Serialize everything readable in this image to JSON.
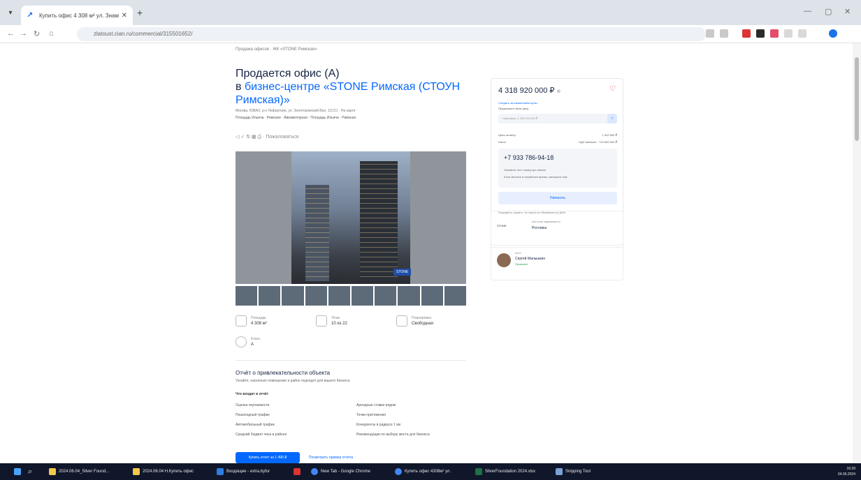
{
  "browser": {
    "tab_title": "Купить офис 4 308 м² ул. Знам...",
    "tab_close": "✕",
    "new_tab": "+",
    "url": "zlatoust.cian.ru/commercial/315501652/",
    "window_controls": [
      "—",
      "▢",
      "✕"
    ],
    "nav_icons": [
      "←",
      "→",
      "↻",
      "⌂"
    ]
  },
  "page": {
    "breadcrumb": "Продажа офисов · ЖК «STONE Римская»",
    "title_prefix": "Продается офис (А)",
    "title_in": "в ",
    "title_link": "бизнес-центре «STONE Римская (СТОУН Римская)»",
    "address": "Москва, ЮВАО, р-н Лефортово, ул. Золоторожский Вал, 11С21 · На карте",
    "metro": "Площадь Ильича · Римская · Авиамоторная · Площадь Ильича · Римская",
    "actions": "◁  ✓  ⇅  ▦  ⎙  · Пожаловаться",
    "photo_logo": "STONE",
    "facts": [
      {
        "label": "Площадь",
        "value": "4 308 м²"
      },
      {
        "label": "Этаж",
        "value": "10 из 22"
      },
      {
        "label": "Планировка",
        "value": "Свободная"
      },
      {
        "label": "Класс",
        "value": "А"
      }
    ],
    "report": {
      "title": "Отчёт о привлекательности объекта",
      "subtitle": "Узнайте, насколько помещение и район подходят для вашего бизнеса",
      "heading": "Что входит в отчёт",
      "items_left": [
        "Оценка окупаемости",
        "Пешеходный трафик",
        "Автомобильный трафик",
        "Средний бюджет чека в районе"
      ],
      "items_right": [
        "Арендные ставки рядом",
        "Точки притяжения",
        "Конкуренты в радиусе 1 км",
        "Рекомендации по выбору места для бизнеса"
      ],
      "button": "Купить отчёт за 1 490 ₽",
      "link": "Посмотреть пример отчёта"
    }
  },
  "card": {
    "price": "4 318 920 000 ₽",
    "price_suffix": "⊕",
    "heart": "♡",
    "link_small": "Следить за изменением цены",
    "text_small": "Предложите свою цену",
    "offer_placeholder": "Например, 4 318 920 000 ₽",
    "offer_btn": "›",
    "rows": [
      {
        "k": "Цена за метр",
        "v": "1 002 563 ₽"
      },
      {
        "k": "Налог",
        "v": "НДС включен · 719 820 000 ₽"
      }
    ],
    "phone": "+7 933 786-94-18",
    "phone_note_1": "Назовите этот номер при звонке",
    "phone_note_2": "Если звоните в нерабочее время, напишите нам",
    "write_btn": "Написать",
    "tiny_note": "Пожалуйста, скажите, что нашли это объявление на ЦИАН"
  },
  "agency": {
    "logo": "STONE",
    "label": "Агентство недвижимости",
    "name": "Ростовка"
  },
  "agent": {
    "label": "Агент",
    "name": "Сергей Малышкин",
    "status": "Проверен"
  },
  "taskbar": {
    "items": [
      "2024.06.04_Silver Found...",
      "2024.06.04 Н.Купить офис",
      "Входящие - extra.byfur",
      "New Tab - Google Chrome",
      "Купить офис 4308м² ул.",
      "SilverFoundation 2024.xlsx",
      "Snipping Tool"
    ],
    "time": "16:39",
    "date": "04.06.2024"
  }
}
